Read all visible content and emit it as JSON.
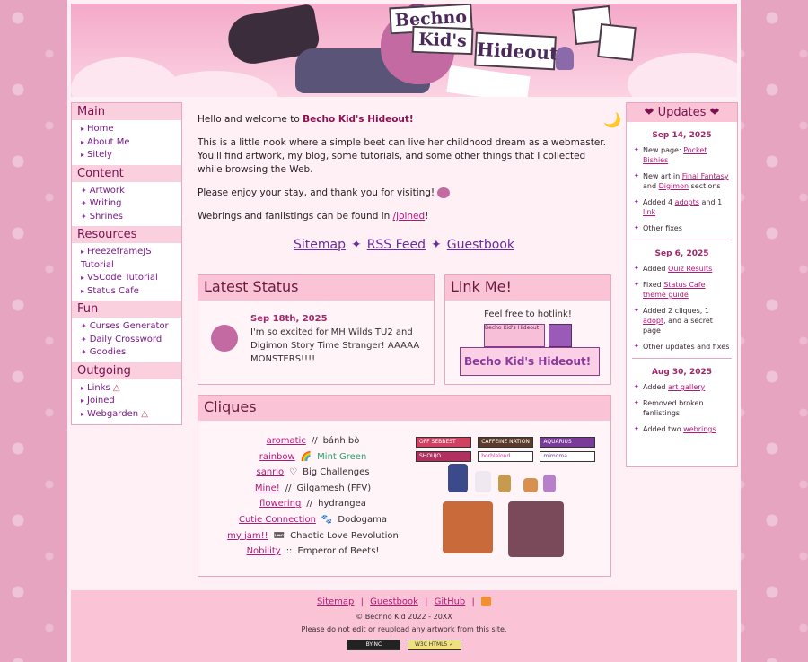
{
  "banner": {
    "title_line1": "Bechno",
    "title_line2": "Kid's",
    "title_line3": "Hideout"
  },
  "sidebar": {
    "sections": [
      {
        "title": "Main",
        "items": [
          "Home",
          "About Me",
          "Sitely"
        ]
      },
      {
        "title": "Content",
        "items": [
          "Artwork",
          "Writing",
          "Shrines"
        ]
      },
      {
        "title": "Resources",
        "items": [
          "FreezeframeJS Tutorial",
          "VSCode Tutorial",
          "Status Cafe"
        ]
      },
      {
        "title": "Fun",
        "items": [
          "Curses Generator",
          "Daily Crossword",
          "Goodies"
        ]
      },
      {
        "title": "Outgoing",
        "items": [
          "Links",
          "Joined",
          "Webgarden"
        ]
      }
    ]
  },
  "intro": {
    "greeting_prefix": "Hello and welcome to ",
    "greeting_site": "Becho Kid's Hideout!",
    "para1": "This is a little nook where a simple beet can live her childhood dream as a webmaster. You'll find artwork, my blog, some tutorials, and some other things that I collected while browsing the Web.",
    "para2": "Please enjoy your stay, and thank you for visiting!",
    "para3_prefix": "Webrings and fanlistings can be found in ",
    "para3_link": "/joined",
    "para3_suffix": "!"
  },
  "bigmenu": {
    "sitemap": "Sitemap",
    "rss": "RSS Feed",
    "guestbook": "Guestbook",
    "separator": "✦"
  },
  "status": {
    "title": "Latest Status",
    "date": "Sep 18th, 2025",
    "text": "I'm so excited for MH Wilds TU2 and Digimon Story Time Stranger! AAAAA MONSTERS!!!!"
  },
  "linkme": {
    "title": "Link Me!",
    "text": "Feel free to hotlink!",
    "button_text_1": "Becho Kid's Hideout",
    "banner_text": "Becho Kid's Hideout!"
  },
  "cliques": {
    "title": "Cliques",
    "rows": [
      {
        "link": "aromatic",
        "sep": "//",
        "value": "bánh bò"
      },
      {
        "link": "rainbow",
        "sep": "🌈",
        "value": "Mint Green"
      },
      {
        "link": "sanrio",
        "sep": "♡",
        "value": "Big Challenges"
      },
      {
        "link": "Mine!",
        "sep": "//",
        "value": "Gilgamesh (FFV)"
      },
      {
        "link": "flowering",
        "sep": "//",
        "value": "hydrangea"
      },
      {
        "link": "Cutie Connection",
        "sep": "🐾",
        "value": "Dodogama"
      },
      {
        "link": "my jam!!",
        "sep": "📼",
        "value": "Chaotic Love Revolution"
      },
      {
        "link": "Nobility",
        "sep": "::",
        "value": "Emperor of Beets!"
      }
    ],
    "badges": [
      "OFF SEBBEST",
      "CAFFEINE NATION",
      "AQUARIUS",
      "SHOUJO",
      "borblelond",
      "mimoma"
    ]
  },
  "updates": {
    "title": "Updates",
    "groups": [
      {
        "date": "Sep 14, 2025",
        "items": [
          {
            "pre": "New page: ",
            "link": "Pocket Bishies",
            "post": ""
          },
          {
            "pre": "New art in ",
            "link": "Final Fantasy",
            "mid": " and ",
            "link2": "Digimon",
            "post": " sections"
          },
          {
            "pre": "Added 4 ",
            "link": "adopts",
            "mid": " and 1 ",
            "link2": "link",
            "post": ""
          },
          {
            "pre": "Other fixes",
            "link": "",
            "post": ""
          }
        ]
      },
      {
        "date": "Sep 6, 2025",
        "items": [
          {
            "pre": "Added ",
            "link": "Quiz Results",
            "post": ""
          },
          {
            "pre": "Fixed ",
            "link": "Status Cafe theme guide",
            "post": ""
          },
          {
            "pre": "Added 2 cliques, 1 ",
            "link": "adopt",
            "post": ", and a secret page"
          },
          {
            "pre": "Other updates and fixes",
            "link": "",
            "post": ""
          }
        ]
      },
      {
        "date": "Aug 30, 2025",
        "items": [
          {
            "pre": "Added ",
            "link": "art gallery",
            "post": ""
          },
          {
            "pre": "Removed broken fanlistings",
            "link": "",
            "post": ""
          },
          {
            "pre": "Added two ",
            "link": "webrings",
            "post": ""
          }
        ]
      }
    ]
  },
  "footer": {
    "links": [
      "Sitemap",
      "Guestbook",
      "GitHub"
    ],
    "copyright": "© Bechno Kid 2022 - 20XX",
    "notice": "Please do not edit or reupload any artwork from this site.",
    "badge_cc": "BY-NC",
    "badge_w3c": "W3C HTML5 ✓"
  },
  "colors": {
    "accent": "#b4167a",
    "header_bg": "#fbc4d6",
    "page_bg": "#e6a4c0"
  }
}
